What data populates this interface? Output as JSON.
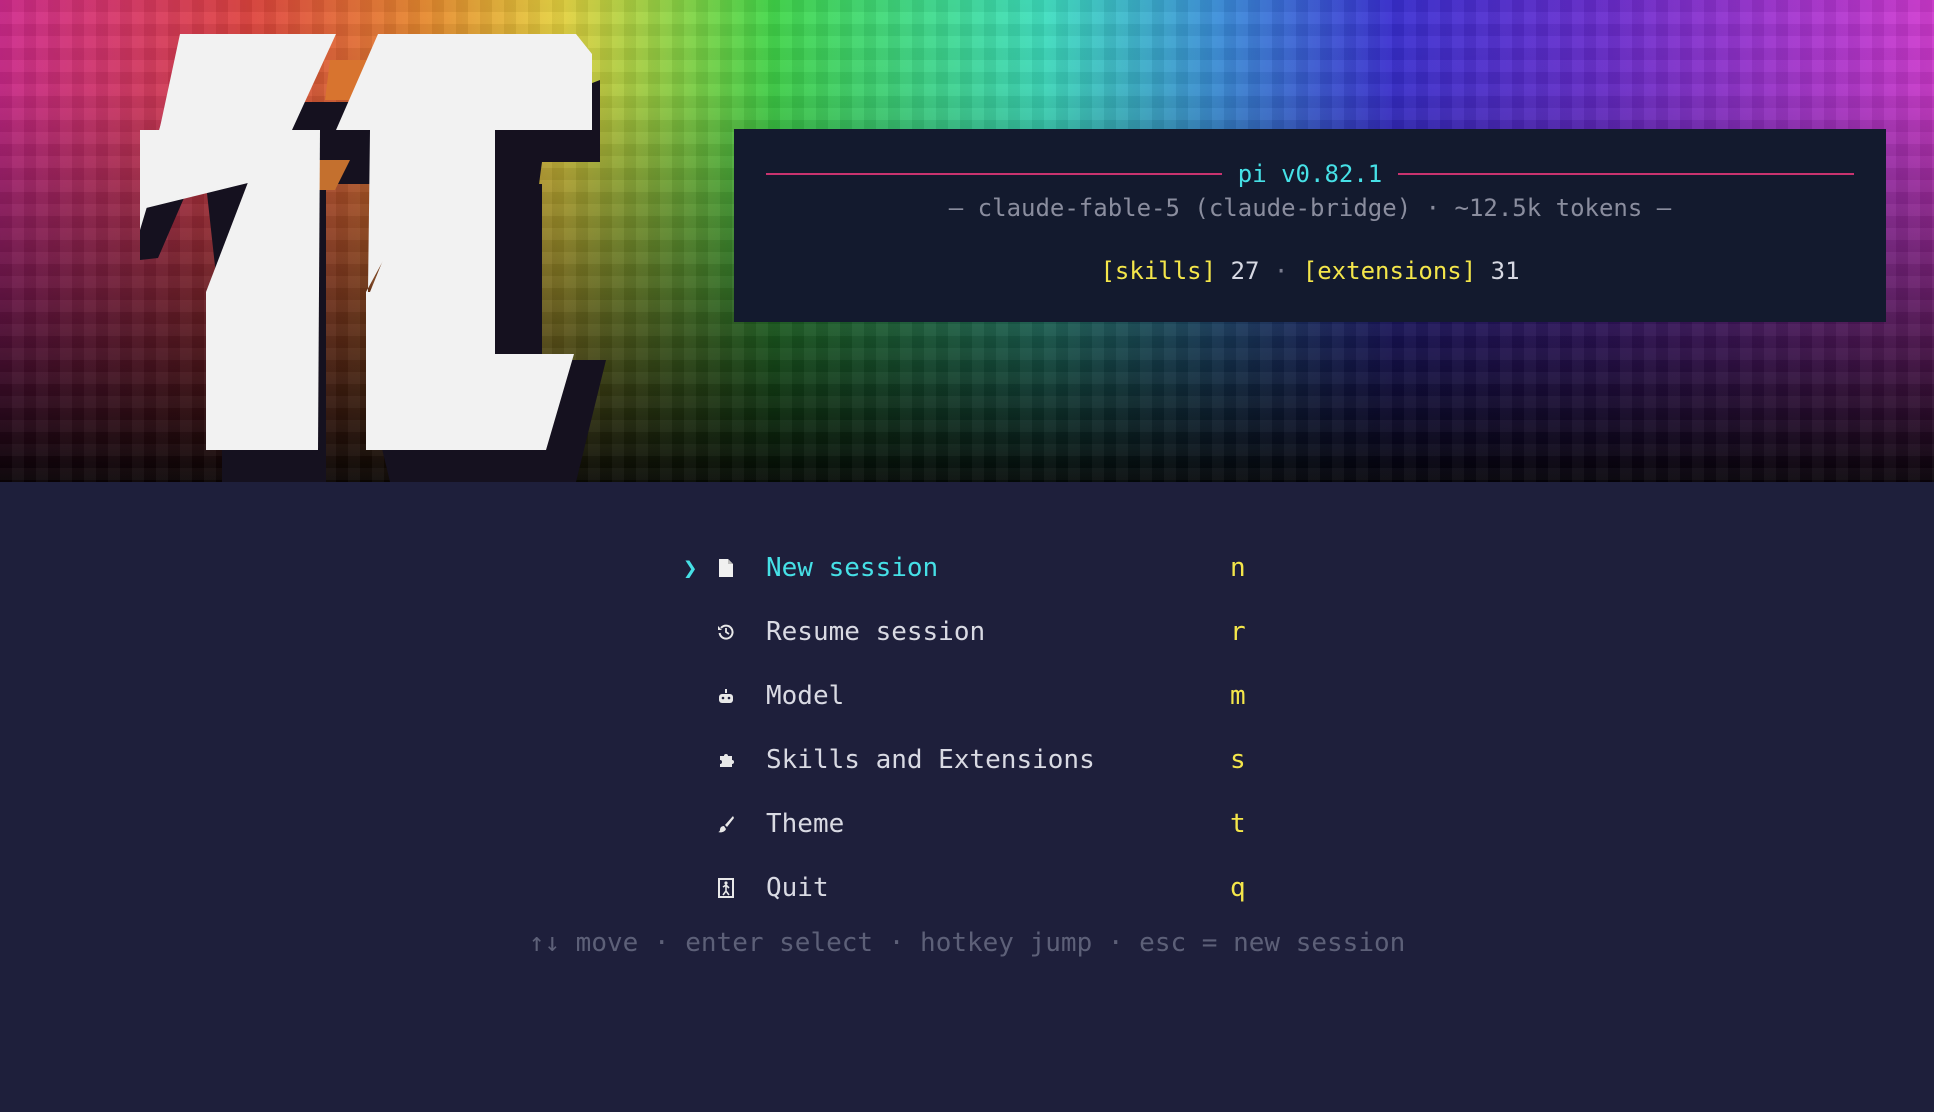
{
  "header": {
    "title": "pi v0.82.1",
    "model_line": "– claude-fable-5 (claude-bridge) · ~12.5k tokens –",
    "stats": {
      "skills_label": "[skills]",
      "skills_count": "27",
      "separator": "·",
      "extensions_label": "[extensions]",
      "extensions_count": "31"
    }
  },
  "menu": {
    "selected_marker": "❯",
    "items": [
      {
        "label": "New session",
        "hotkey": "n",
        "icon": "document-icon",
        "selected": true
      },
      {
        "label": "Resume session",
        "hotkey": "r",
        "icon": "history-icon",
        "selected": false
      },
      {
        "label": "Model",
        "hotkey": "m",
        "icon": "robot-icon",
        "selected": false
      },
      {
        "label": "Skills and Extensions",
        "hotkey": "s",
        "icon": "puzzle-icon",
        "selected": false
      },
      {
        "label": "Theme",
        "hotkey": "t",
        "icon": "brush-icon",
        "selected": false
      },
      {
        "label": "Quit",
        "hotkey": "q",
        "icon": "exit-icon",
        "selected": false
      }
    ]
  },
  "hint": "↑↓ move · enter select · hotkey jump · esc = new session",
  "colors": {
    "background": "#1e1f3b",
    "info_box": "#131a2e",
    "accent_cyan": "#46e0e6",
    "accent_yellow": "#f4e64a",
    "title_rule": "#c9336f",
    "muted_text": "#8a8d9e"
  }
}
